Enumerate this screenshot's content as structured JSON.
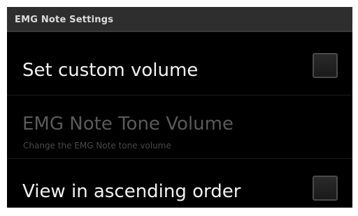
{
  "header": {
    "title": "EMG Note Settings"
  },
  "preferences": [
    {
      "title": "Set custom volume",
      "checked": false,
      "enabled": true
    },
    {
      "title": "EMG Note Tone Volume",
      "summary": "Change the EMG Note tone volume",
      "enabled": false
    },
    {
      "title": "View in ascending order",
      "checked": false,
      "enabled": true
    }
  ],
  "colors": {
    "background": "#000000",
    "header_background": "#2e2e2e",
    "text_primary": "#f2f2f2",
    "text_disabled": "#5a5a5a"
  }
}
